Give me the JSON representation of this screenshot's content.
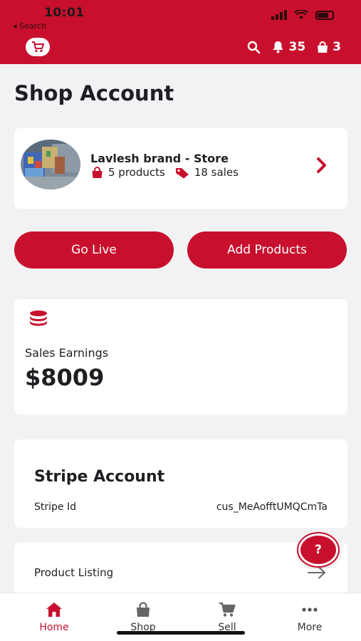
{
  "status_bar": {
    "time": "10:01",
    "back_label": "◂ Search"
  },
  "top_bar": {
    "notifications_count": "35",
    "bag_count": "3"
  },
  "page": {
    "title": "Shop Account"
  },
  "store": {
    "name": "Lavlesh brand - Store",
    "products_text": "5 products",
    "sales_text": "18 sales"
  },
  "actions": {
    "go_live_label": "Go Live",
    "add_products_label": "Add Products"
  },
  "earnings": {
    "label": "Sales Earnings",
    "value": "$8009"
  },
  "stripe": {
    "title": "Stripe Account",
    "id_label": "Stripe Id",
    "id_value": "cus_MeAofftUMQCmTa"
  },
  "listing": {
    "label": "Product Listing"
  },
  "help": {
    "label": "?"
  },
  "tabs": [
    {
      "label": "Home",
      "icon": "home-icon",
      "active": true
    },
    {
      "label": "Shop",
      "icon": "bag-icon",
      "active": false
    },
    {
      "label": "Sell",
      "icon": "cart-icon",
      "active": false
    },
    {
      "label": "More",
      "icon": "more-icon",
      "active": false
    }
  ],
  "colors": {
    "brand": "#c8102e",
    "background": "#f2f2f4",
    "card": "#ffffff"
  }
}
